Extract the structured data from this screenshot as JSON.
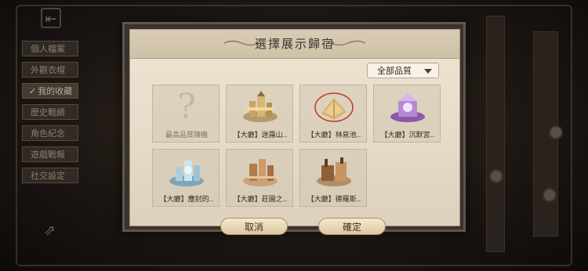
{
  "sidebar": {
    "items": [
      {
        "label": "個人檔案"
      },
      {
        "label": "外觀衣帽"
      },
      {
        "label": "我的收藏",
        "active": true
      },
      {
        "label": "歷史戰績"
      },
      {
        "label": "角色紀念"
      },
      {
        "label": "遊戲戰報"
      },
      {
        "label": "社交設定"
      }
    ]
  },
  "dialog": {
    "title": "選擇展示歸宿",
    "filter": {
      "selected": "全部品質"
    },
    "items": [
      {
        "label": "最高品質隨機",
        "icon": "question-mark-icon"
      },
      {
        "label": "【大廳】迷霧山..",
        "icon": "castle-hall-icon"
      },
      {
        "label": "【大廳】林泉池..",
        "icon": "book-hall-icon",
        "selected": true
      },
      {
        "label": "【大廳】沉默宮..",
        "icon": "purple-palace-icon"
      },
      {
        "label": "【大廳】塵封的..",
        "icon": "ice-city-icon"
      },
      {
        "label": "【大廳】莊園之..",
        "icon": "manor-hall-icon"
      },
      {
        "label": "【大廳】德羅斯..",
        "icon": "factory-hall-icon"
      }
    ],
    "cancel_label": "取消",
    "confirm_label": "確定"
  },
  "colors": {
    "paper": "#e9decb",
    "accent_red": "#c0392b",
    "button_gold": "#dcc9a0"
  }
}
